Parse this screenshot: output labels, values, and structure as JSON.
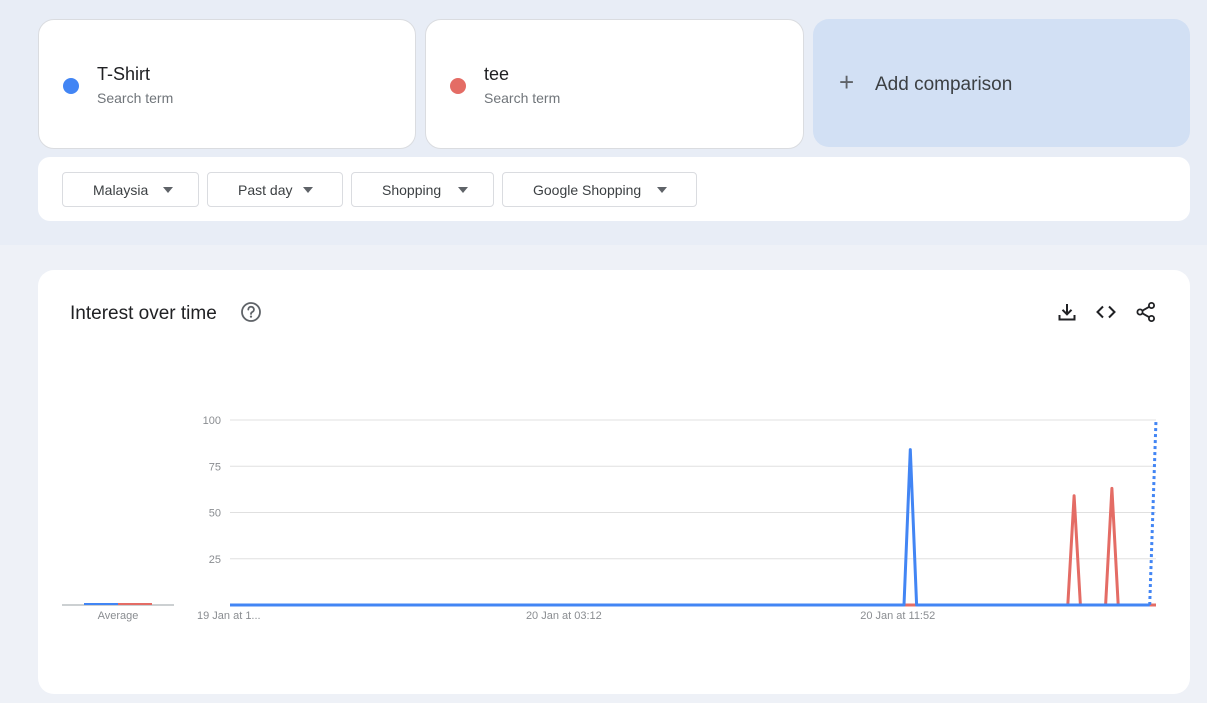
{
  "terms": [
    {
      "name": "T-Shirt",
      "sub": "Search term",
      "color": "#4285f4"
    },
    {
      "name": "tee",
      "sub": "Search term",
      "color": "#e46c65"
    }
  ],
  "add_comparison": {
    "label": "Add comparison",
    "icon": "plus-icon"
  },
  "filters": [
    {
      "label": "Malaysia"
    },
    {
      "label": "Past day"
    },
    {
      "label": "Shopping"
    },
    {
      "label": "Google Shopping"
    }
  ],
  "panel": {
    "title": "Interest over time",
    "icons": [
      "help-icon",
      "download-icon",
      "embed-icon",
      "share-icon"
    ]
  },
  "chart_data": {
    "type": "line",
    "title": "Interest over time",
    "ylim": [
      0,
      100
    ],
    "yticks": [
      25,
      50,
      75,
      100
    ],
    "grid": true,
    "average_label": "Average",
    "x_tick_labels": [
      {
        "label": "19 Jan at 1...",
        "index": 0
      },
      {
        "label": "20 Jan at 03:12",
        "index": 53
      },
      {
        "label": "20 Jan at 11:52",
        "index": 106
      }
    ],
    "n_points": 148,
    "series": [
      {
        "name": "T-Shirt",
        "color": "#4285f4",
        "peaks": [
          {
            "index": 108,
            "value": 84
          }
        ],
        "partial_last_value": 100
      },
      {
        "name": "tee",
        "color": "#e46c65",
        "peaks": [
          {
            "index": 134,
            "value": 59
          },
          {
            "index": 140,
            "value": 63
          }
        ]
      }
    ]
  }
}
